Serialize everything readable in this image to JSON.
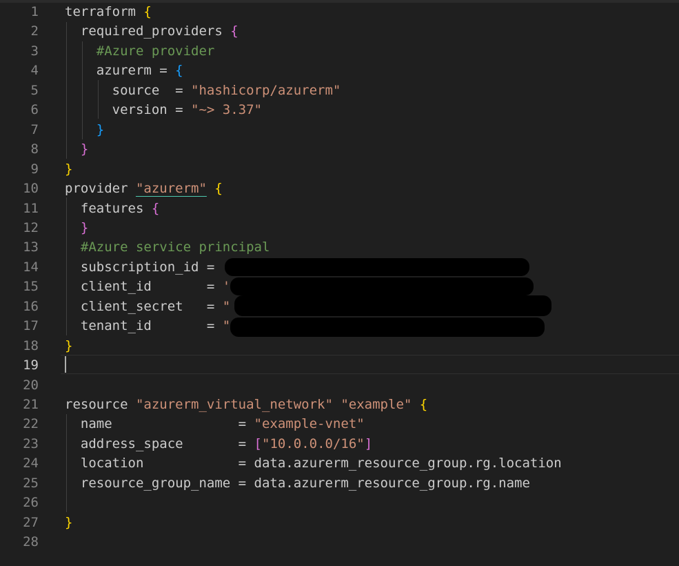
{
  "editor": {
    "lines": [
      {
        "num": "1",
        "tokens": [
          {
            "t": "terraform ",
            "c": "plain"
          },
          {
            "t": "{",
            "c": "bracket1"
          }
        ]
      },
      {
        "num": "2",
        "tokens": [
          {
            "t": "  required_providers ",
            "c": "plain"
          },
          {
            "t": "{",
            "c": "bracket2"
          }
        ]
      },
      {
        "num": "3",
        "tokens": [
          {
            "t": "    #Azure provider",
            "c": "comment"
          }
        ]
      },
      {
        "num": "4",
        "tokens": [
          {
            "t": "    azurerm = ",
            "c": "plain"
          },
          {
            "t": "{",
            "c": "bracket3"
          }
        ]
      },
      {
        "num": "5",
        "tokens": [
          {
            "t": "      source  = ",
            "c": "plain"
          },
          {
            "t": "\"hashicorp/azurerm\"",
            "c": "string"
          }
        ]
      },
      {
        "num": "6",
        "tokens": [
          {
            "t": "      version = ",
            "c": "plain"
          },
          {
            "t": "\"~> 3.37\"",
            "c": "string"
          }
        ]
      },
      {
        "num": "7",
        "tokens": [
          {
            "t": "    ",
            "c": "plain"
          },
          {
            "t": "}",
            "c": "bracket3"
          }
        ]
      },
      {
        "num": "8",
        "tokens": [
          {
            "t": "  ",
            "c": "plain"
          },
          {
            "t": "}",
            "c": "bracket2"
          }
        ]
      },
      {
        "num": "9",
        "tokens": [
          {
            "t": "}",
            "c": "bracket1"
          }
        ]
      },
      {
        "num": "10",
        "tokens": [
          {
            "t": "provider ",
            "c": "plain"
          },
          {
            "t": "\"azurerm\"",
            "c": "string",
            "u": true
          },
          {
            "t": " ",
            "c": "plain"
          },
          {
            "t": "{",
            "c": "bracket1"
          }
        ]
      },
      {
        "num": "11",
        "tokens": [
          {
            "t": "  features ",
            "c": "plain"
          },
          {
            "t": "{",
            "c": "bracket2"
          }
        ]
      },
      {
        "num": "12",
        "tokens": [
          {
            "t": "  ",
            "c": "plain"
          },
          {
            "t": "}",
            "c": "bracket2"
          }
        ]
      },
      {
        "num": "13",
        "tokens": [
          {
            "t": "  #Azure service principal",
            "c": "comment"
          }
        ]
      },
      {
        "num": "14",
        "tokens": [
          {
            "t": "  subscription_id = ",
            "c": "plain"
          }
        ]
      },
      {
        "num": "15",
        "tokens": [
          {
            "t": "  client_id       = ",
            "c": "plain"
          },
          {
            "t": "'",
            "c": "string"
          }
        ]
      },
      {
        "num": "16",
        "tokens": [
          {
            "t": "  client_secret   = ",
            "c": "plain"
          },
          {
            "t": "\"",
            "c": "string"
          }
        ]
      },
      {
        "num": "17",
        "tokens": [
          {
            "t": "  tenant_id       = ",
            "c": "plain"
          },
          {
            "t": "\"",
            "c": "string"
          }
        ]
      },
      {
        "num": "18",
        "tokens": [
          {
            "t": "}",
            "c": "bracket1"
          }
        ]
      },
      {
        "num": "19",
        "tokens": []
      },
      {
        "num": "20",
        "tokens": []
      },
      {
        "num": "21",
        "tokens": [
          {
            "t": "resource ",
            "c": "plain"
          },
          {
            "t": "\"azurerm_virtual_network\" \"example\" ",
            "c": "string"
          },
          {
            "t": "{",
            "c": "bracket1"
          }
        ]
      },
      {
        "num": "22",
        "tokens": [
          {
            "t": "  name                = ",
            "c": "plain"
          },
          {
            "t": "\"example-vnet\"",
            "c": "string"
          }
        ]
      },
      {
        "num": "23",
        "tokens": [
          {
            "t": "  address_space       = ",
            "c": "plain"
          },
          {
            "t": "[",
            "c": "bracket2"
          },
          {
            "t": "\"10.0.0.0/16\"",
            "c": "string"
          },
          {
            "t": "]",
            "c": "bracket2"
          }
        ]
      },
      {
        "num": "24",
        "tokens": [
          {
            "t": "  location            = data.azurerm_resource_group.rg.location",
            "c": "plain"
          }
        ]
      },
      {
        "num": "25",
        "tokens": [
          {
            "t": "  resource_group_name = data.azurerm_resource_group.rg.name",
            "c": "plain"
          }
        ]
      },
      {
        "num": "26",
        "tokens": []
      },
      {
        "num": "27",
        "tokens": [
          {
            "t": "}",
            "c": "bracket1"
          }
        ]
      },
      {
        "num": "28",
        "tokens": []
      }
    ],
    "active_line": "19",
    "colors": {
      "background": "#1f1f1f",
      "bracket_level1": "#ffd700",
      "bracket_level2": "#da70d6",
      "bracket_level3": "#179fff",
      "comment": "#6a9955",
      "string": "#ce9178",
      "plain": "#cccccc",
      "line_number": "#858585"
    }
  }
}
